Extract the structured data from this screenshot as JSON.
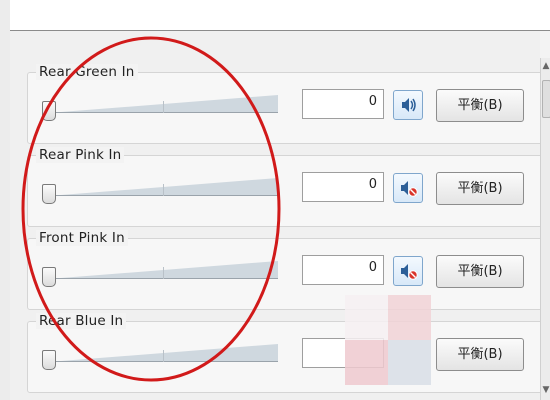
{
  "channels": [
    {
      "label": "Rear Green In",
      "value": "0",
      "mute_icon": "speaker-on-icon",
      "balance_label": "平衡(B)"
    },
    {
      "label": "Rear Pink In",
      "value": "0",
      "mute_icon": "speaker-muted-icon",
      "balance_label": "平衡(B)"
    },
    {
      "label": "Front Pink In",
      "value": "0",
      "mute_icon": "speaker-muted-icon",
      "balance_label": "平衡(B)"
    },
    {
      "label": "Rear Blue In",
      "value": "",
      "mute_icon": "",
      "balance_label": "平衡(B)"
    }
  ],
  "slider_level": 0,
  "annotation_color": "#d11a1a"
}
